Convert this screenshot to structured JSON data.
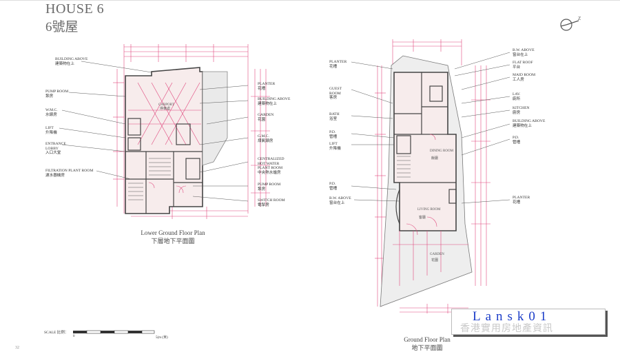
{
  "header": {
    "title_en": "HOUSE 6",
    "title_zh": "6號屋"
  },
  "lower_ground": {
    "left_labels": [
      {
        "en": "BUILDING ABOVE",
        "zh": "建築物在上"
      },
      {
        "en": "PUMP ROOM",
        "zh": "泵房"
      },
      {
        "en": "W.M.C.",
        "zh": "水錶房"
      },
      {
        "en": "LIFT",
        "zh": "升降機"
      },
      {
        "en": "ENTRANCE\nLOBBY",
        "zh": "入口大堂"
      },
      {
        "en": "FILTRATION PLANT ROOM",
        "zh": "濾水器機房"
      }
    ],
    "right_labels": [
      {
        "en": "PLANTER",
        "zh": "花槽"
      },
      {
        "en": "BUILDING ABOVE",
        "zh": "建築物在上"
      },
      {
        "en": "GARDEN",
        "zh": "花園"
      },
      {
        "en": "G.M.C.",
        "zh": "煤氣錶房"
      },
      {
        "en": "CENTRALIZED\nHOT WATER\nPLANT ROOM",
        "zh": "中央熱水爐房"
      },
      {
        "en": "PUMP ROOM",
        "zh": "泵房"
      },
      {
        "en": "SWITCH ROOM",
        "zh": "電掣房"
      }
    ],
    "room_carport": {
      "en": "CARPORT",
      "zh": "停車處"
    },
    "title_en": "Lower Ground Floor Plan",
    "title_zh": "下層地下平面圖"
  },
  "ground": {
    "left_labels": [
      {
        "en": "PLANTER",
        "zh": "花槽"
      },
      {
        "en": "GUEST\nROOM",
        "zh": "客房"
      },
      {
        "en": "BATH",
        "zh": "浴室"
      },
      {
        "en": "P.D.",
        "zh": "管槽"
      },
      {
        "en": "LIFT",
        "zh": "升降機"
      },
      {
        "en": "P.D.",
        "zh": "管槽"
      },
      {
        "en": "B.W. ABOVE",
        "zh": "窗台在上"
      }
    ],
    "right_labels": [
      {
        "en": "B.W. ABOVE",
        "zh": "窗台在上"
      },
      {
        "en": "FLAT ROOF",
        "zh": "平台"
      },
      {
        "en": "MAID ROOM",
        "zh": "工人房"
      },
      {
        "en": "LAV.",
        "zh": "廁所"
      },
      {
        "en": "KITCHEN",
        "zh": "廚房"
      },
      {
        "en": "BUILDING ABOVE",
        "zh": "建築物在上"
      },
      {
        "en": "P.D.",
        "zh": "管槽"
      },
      {
        "en": "PLANTER",
        "zh": "花槽"
      }
    ],
    "room_dining": {
      "en": "DINING\nROOM",
      "zh": "飯廳"
    },
    "room_living": {
      "en": "LIVING\nROOM",
      "zh": "客廳"
    },
    "room_garden": {
      "en": "GARDEN",
      "zh": "花園"
    },
    "title_en": "Ground Floor Plan",
    "title_zh": "地下平面圖"
  },
  "scale": {
    "label": "SCALE 比例：",
    "zero": "0",
    "end": "5(m (米)"
  },
  "watermark": {
    "text": "Lansk01",
    "sub": "香港實用房地產資訊"
  },
  "page_number": "32"
}
